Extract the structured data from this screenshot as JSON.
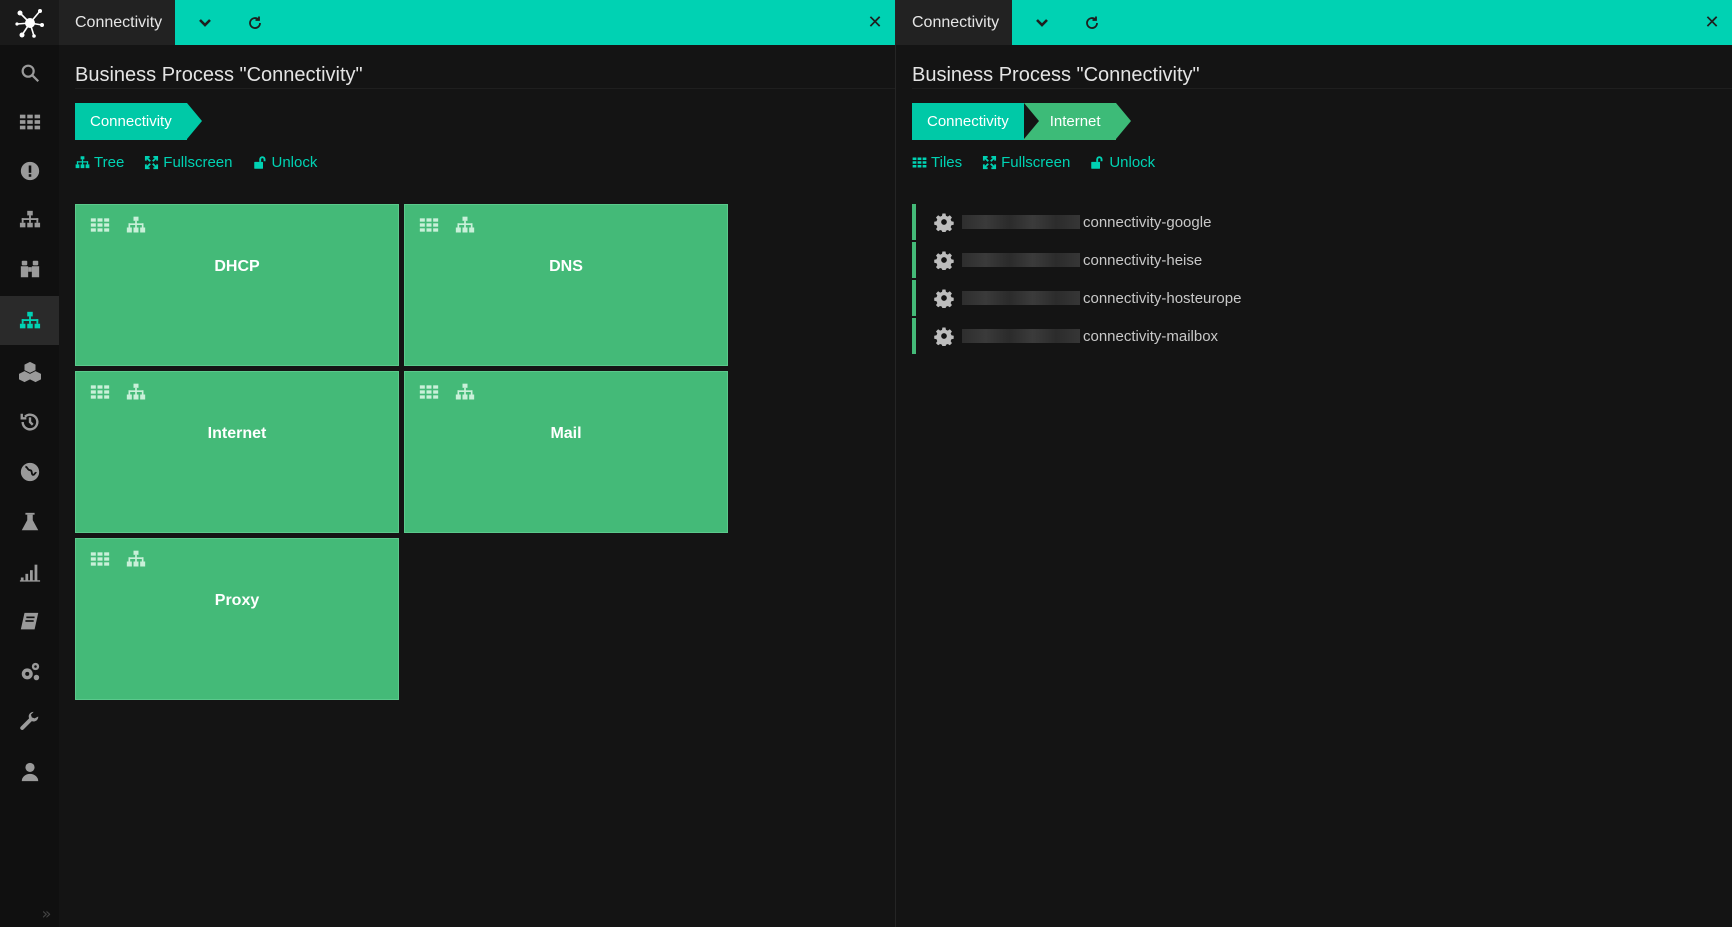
{
  "colors": {
    "accent": "#00d2b3",
    "ok": "#44ba78",
    "background": "#141414"
  },
  "sidebar": {
    "icons": [
      "search-icon",
      "dashboard-icon",
      "problems-icon",
      "overview-icon",
      "history-icon",
      "business-process-icon",
      "cubes-icon",
      "history-rewind-icon",
      "globe-icon",
      "lab-icon",
      "reporting-icon",
      "documentation-icon",
      "system-icon",
      "configuration-icon",
      "user-icon"
    ],
    "active": "business-process-icon"
  },
  "left": {
    "tab": "Connectivity",
    "title": "Business Process \"Connectivity\"",
    "breadcrumbs": [
      "Connectivity"
    ],
    "actions": {
      "view": "Tree",
      "fullscreen": "Fullscreen",
      "lock": "Unlock"
    },
    "tiles": [
      "DHCP",
      "DNS",
      "Internet",
      "Mail",
      "Proxy"
    ]
  },
  "right": {
    "tab": "Connectivity",
    "title": "Business Process \"Connectivity\"",
    "breadcrumbs": [
      "Connectivity",
      "Internet"
    ],
    "actions": {
      "view": "Tiles",
      "fullscreen": "Fullscreen",
      "lock": "Unlock"
    },
    "services": [
      "connectivity-google",
      "connectivity-heise",
      "connectivity-hosteurope",
      "connectivity-mailbox"
    ]
  }
}
